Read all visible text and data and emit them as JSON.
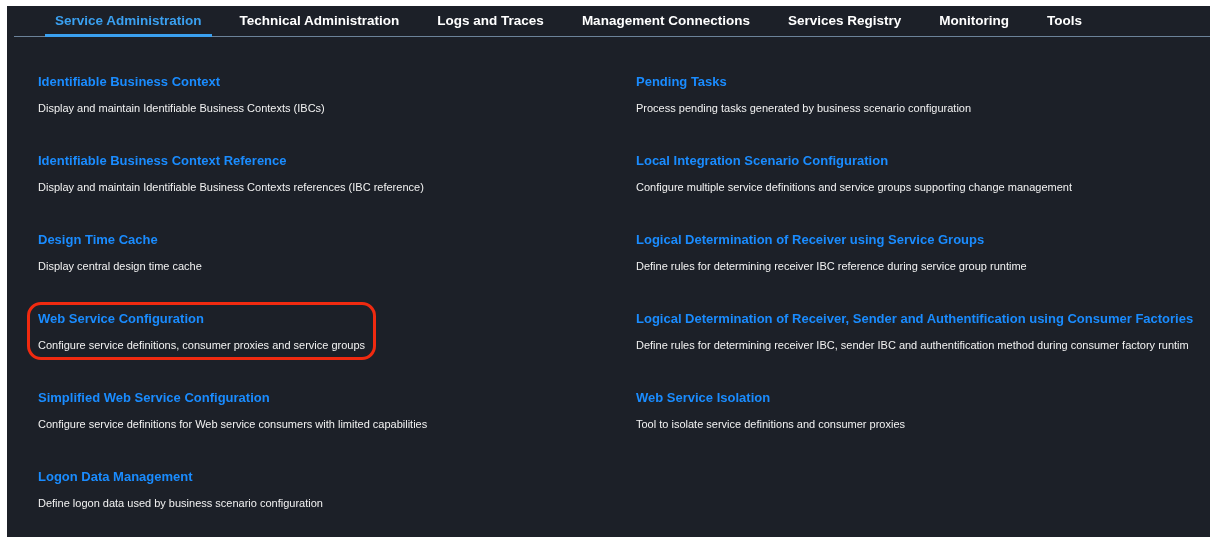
{
  "tabs": [
    {
      "label": "Service Administration",
      "selected": true
    },
    {
      "label": "Technical Administration",
      "selected": false
    },
    {
      "label": "Logs and Traces",
      "selected": false
    },
    {
      "label": "Management Connections",
      "selected": false
    },
    {
      "label": "Services Registry",
      "selected": false
    },
    {
      "label": "Monitoring",
      "selected": false
    },
    {
      "label": "Tools",
      "selected": false
    }
  ],
  "columns": [
    {
      "items": [
        {
          "title": "Identifiable Business Context",
          "description": "Display and maintain Identifiable Business Contexts (IBCs)",
          "highlighted": false
        },
        {
          "title": "Identifiable Business Context Reference",
          "description": "Display and maintain Identifiable Business Contexts references (IBC reference)",
          "highlighted": false
        },
        {
          "title": "Design Time Cache",
          "description": "Display central design time cache",
          "highlighted": false
        },
        {
          "title": "Web Service Configuration",
          "description": "Configure service definitions, consumer proxies and service groups",
          "highlighted": true
        },
        {
          "title": "Simplified Web Service Configuration",
          "description": "Configure service definitions for Web service consumers with limited capabilities",
          "highlighted": false
        },
        {
          "title": "Logon Data Management",
          "description": "Define logon data used by business scenario configuration",
          "highlighted": false
        }
      ]
    },
    {
      "items": [
        {
          "title": "Pending Tasks",
          "description": "Process pending tasks generated by business scenario configuration",
          "highlighted": false
        },
        {
          "title": "Local Integration Scenario Configuration",
          "description": "Configure multiple service definitions and service groups supporting change management",
          "highlighted": false
        },
        {
          "title": "Logical Determination of Receiver using Service Groups",
          "description": "Define rules for determining receiver IBC reference during service group runtime",
          "highlighted": false
        },
        {
          "title": "Logical Determination of Receiver, Sender and Authentification using Consumer Factories",
          "description": "Define rules for determining receiver IBC, sender IBC and authentification method during consumer factory runtim",
          "highlighted": false
        },
        {
          "title": "Web Service Isolation",
          "description": "Tool to isolate service definitions and consumer proxies",
          "highlighted": false
        }
      ]
    }
  ]
}
